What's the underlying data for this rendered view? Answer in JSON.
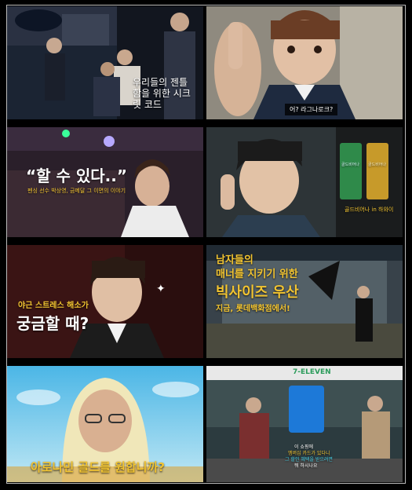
{
  "colors": {
    "gold": "#f2c431",
    "red": "#e23b3b",
    "teal": "#48d0e6"
  },
  "tiles": [
    {
      "caption": "우리들의 젠틀함을 위한 시크릿 코드"
    },
    {
      "subtitle": "어? 라그나로크?"
    },
    {
      "headline": "“할 수 있다..”",
      "tagline": "펜싱 선수 박상영, 금메달 그 이면의 이야기"
    },
    {
      "product": "골드비어나 in 하와이",
      "can1": "골드비어나",
      "can2": "골드비어나"
    },
    {
      "line1": "야근 스트레스 해소가",
      "line2": "궁금할 때?"
    },
    {
      "line1": "남자들의",
      "line2": "매너를 지키기 위한",
      "line3": "빅사이즈 우산",
      "line4": "지금, 롯데백화점에서!"
    },
    {
      "headline": "아로나민 골드를 원합니까?"
    },
    {
      "sign": "7-ELEVEN",
      "sub1": "이 쇼핑에",
      "sub2": "멤버십 카드가 있다니",
      "sub3": "그 할인 혜택을 받으려면",
      "sub4": "뭐 하시나요"
    }
  ]
}
